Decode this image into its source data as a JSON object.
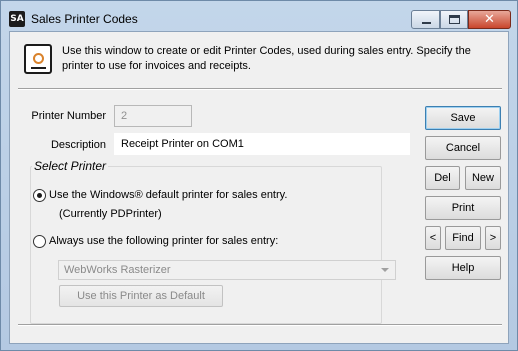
{
  "window": {
    "app_badge": "SA",
    "title": "Sales Printer Codes"
  },
  "info": {
    "text": "Use this window to create or edit Printer Codes, used during sales entry. Specify the printer to use for invoices and receipts."
  },
  "form": {
    "printer_number_label": "Printer Number",
    "printer_number_value": "2",
    "description_label": "Description",
    "description_value": "Receipt Printer on COM1"
  },
  "select_printer": {
    "title": "Select Printer",
    "option_default_label": "Use the Windows® default printer for sales entry.",
    "option_default_checked": true,
    "current_printer_text": "(Currently PDPrinter)",
    "option_specific_label": "Always use the following printer for sales entry:",
    "option_specific_checked": false,
    "printer_combo_value": "WebWorks Rasterizer",
    "use_as_default_label": "Use this Printer as Default"
  },
  "buttons": {
    "save": "Save",
    "cancel": "Cancel",
    "del": "Del",
    "new": "New",
    "print": "Print",
    "prev": "<",
    "find": "Find",
    "next": ">",
    "help": "Help"
  },
  "icons": {
    "app": "sa-app-icon",
    "info": "document-icon",
    "minimize": "minimize-icon",
    "maximize": "maximize-icon",
    "close": "close-icon",
    "dropdown": "chevron-down-icon"
  },
  "colors": {
    "title_bar": "#b4c9e2",
    "close_button": "#c9462c",
    "default_button_border": "#3c7fb1"
  }
}
